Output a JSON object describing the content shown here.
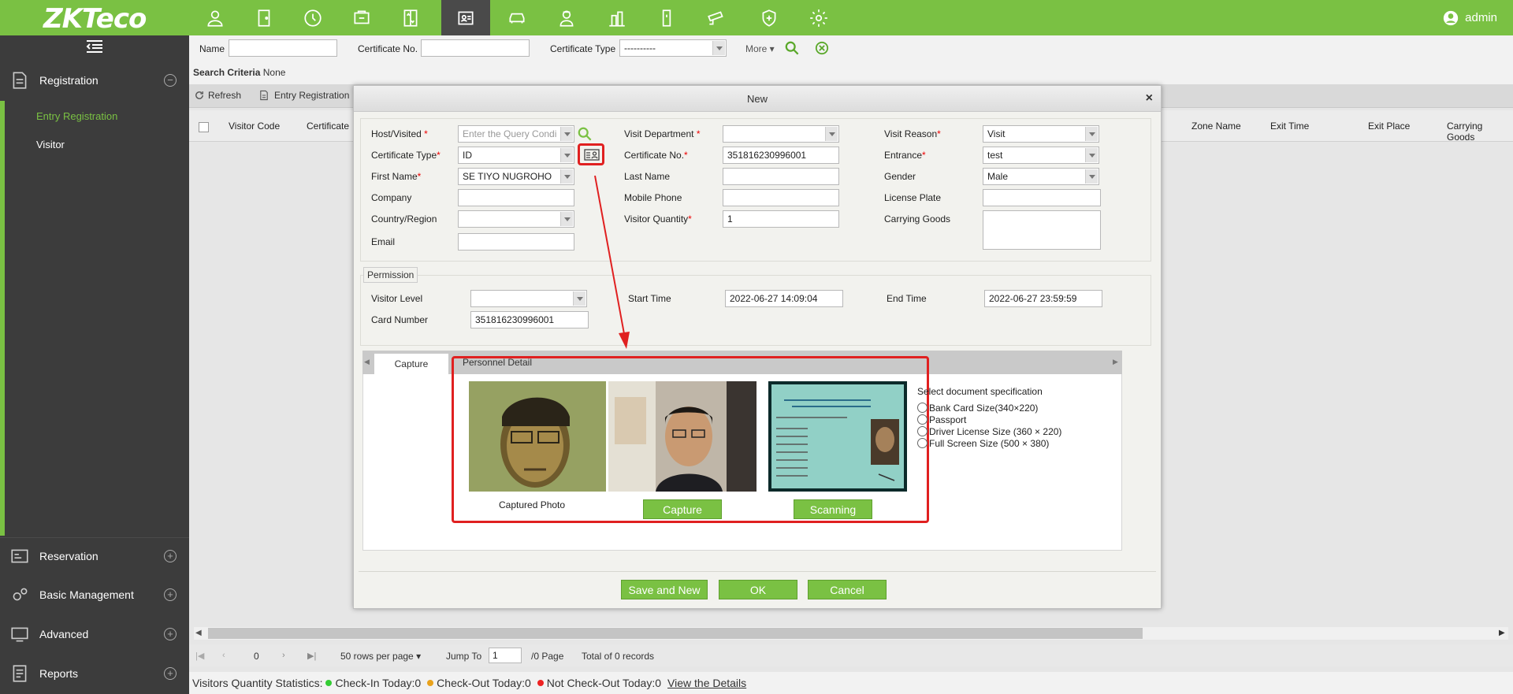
{
  "app": {
    "logo": "ZKTeco",
    "user": "admin"
  },
  "sidebar": {
    "sections": [
      {
        "label": "Registration",
        "toggle": "−"
      },
      {
        "label": "Reservation",
        "toggle": "+"
      },
      {
        "label": "Basic Management",
        "toggle": "+"
      },
      {
        "label": "Advanced",
        "toggle": "+"
      },
      {
        "label": "Reports",
        "toggle": "+"
      }
    ],
    "items": [
      {
        "label": "Entry Registration"
      },
      {
        "label": "Visitor"
      }
    ]
  },
  "search": {
    "name_label": "Name",
    "cert_no_label": "Certificate No.",
    "cert_type_label": "Certificate Type",
    "cert_type_value": "----------",
    "more_label": "More",
    "criteria_label": "Search Criteria",
    "criteria_value": "None"
  },
  "toolbar": {
    "refresh": "Refresh",
    "entry_registration": "Entry Registration"
  },
  "table": {
    "headers": [
      "Visitor Code",
      "Certificate",
      "Zone Name",
      "Exit Time",
      "Exit Place",
      "Carrying Goods"
    ]
  },
  "pagination": {
    "page": "0",
    "rows_per_page": "50 rows per page",
    "jump_to": "Jump To",
    "jump_value": "1",
    "page_total": "/0 Page",
    "total": "Total of 0 records"
  },
  "status": {
    "prefix": "Visitors Quantity Statistics:",
    "checkin": "Check-In Today:0",
    "checkout": "Check-Out Today:0",
    "notcheckout": "Not Check-Out Today:0",
    "details": "View the Details"
  },
  "dialog": {
    "title": "New",
    "fields": {
      "host_label": "Host/Visited",
      "host_placeholder": "Enter the Query Condi",
      "cert_type_label": "Certificate Type",
      "cert_type_value": "ID",
      "first_name_label": "First Name",
      "first_name_value": "SE TIYO NUGROHO",
      "company_label": "Company",
      "country_label": "Country/Region",
      "email_label": "Email",
      "visit_dept_label": "Visit Department",
      "cert_no_label": "Certificate No.",
      "cert_no_value": "351816230996001",
      "last_name_label": "Last Name",
      "mobile_label": "Mobile Phone",
      "visitor_qty_label": "Visitor Quantity",
      "visitor_qty_value": "1",
      "visit_reason_label": "Visit Reason",
      "visit_reason_value": "Visit",
      "entrance_label": "Entrance",
      "entrance_value": "test",
      "gender_label": "Gender",
      "gender_value": "Male",
      "license_label": "License Plate",
      "goods_label": "Carrying Goods"
    },
    "permission": {
      "legend": "Permission",
      "level_label": "Visitor Level",
      "card_label": "Card Number",
      "card_value": "351816230996001",
      "start_label": "Start Time",
      "start_value": "2022-06-27 14:09:04",
      "end_label": "End Time",
      "end_value": "2022-06-27 23:59:59"
    },
    "tabs": [
      "Capture",
      "Personnel Detail"
    ],
    "capture": {
      "captured_photo": "Captured Photo",
      "capture_btn": "Capture",
      "scanning_btn": "Scanning"
    },
    "spec": {
      "title": "Select document specification",
      "options": [
        "Bank Card Size(340×220)",
        "Passport",
        "Driver License Size (360 × 220)",
        "Full Screen Size (500 × 380)"
      ]
    },
    "buttons": {
      "save_new": "Save and New",
      "ok": "OK",
      "cancel": "Cancel"
    }
  },
  "colors": {
    "brand": "#7ac143",
    "sidebar": "#3c3c3c",
    "highlight": "#e02020"
  }
}
